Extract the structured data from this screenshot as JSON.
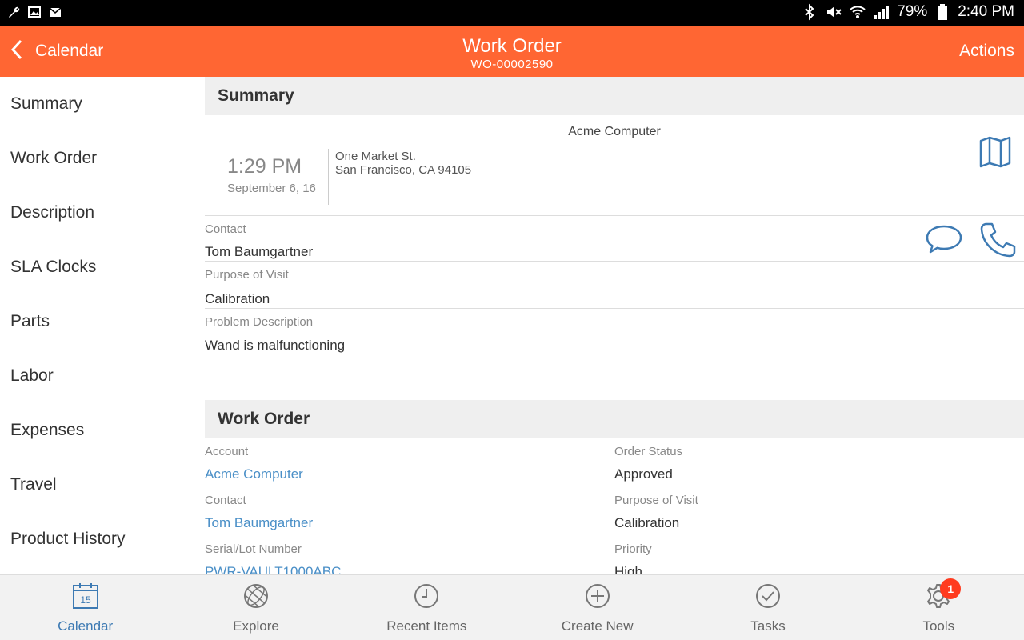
{
  "status_bar": {
    "battery": "79%",
    "time": "2:40 PM"
  },
  "header": {
    "back_label": "Calendar",
    "title": "Work Order",
    "subtitle": "WO-00002590",
    "actions_label": "Actions",
    "accent_color": "#ff6633"
  },
  "sidebar": {
    "items": [
      {
        "label": "Summary"
      },
      {
        "label": "Work Order"
      },
      {
        "label": "Description"
      },
      {
        "label": "SLA Clocks"
      },
      {
        "label": "Parts"
      },
      {
        "label": "Labor"
      },
      {
        "label": "Expenses"
      },
      {
        "label": "Travel"
      },
      {
        "label": "Product History"
      }
    ]
  },
  "summary": {
    "header": "Summary",
    "account_name": "Acme Computer",
    "time": "1:29 PM",
    "date": "September 6, 16",
    "address_line1": "One Market St.",
    "address_line2": "San Francisco, CA 94105",
    "contact_label": "Contact",
    "contact_value": "Tom Baumgartner",
    "purpose_label": "Purpose of Visit",
    "purpose_value": "Calibration",
    "problem_label": "Problem Description",
    "problem_value": "Wand is malfunctioning"
  },
  "work_order": {
    "header": "Work Order",
    "account_label": "Account",
    "account_value": "Acme Computer",
    "order_status_label": "Order Status",
    "order_status_value": "Approved",
    "contact_label": "Contact",
    "contact_value": "Tom Baumgartner",
    "purpose_label": "Purpose of Visit",
    "purpose_value": "Calibration",
    "serial_label": "Serial/Lot Number",
    "serial_value": "PWR-VAULT1000ABC",
    "priority_label": "Priority",
    "priority_value": "High"
  },
  "tabs": [
    {
      "label": "Calendar",
      "icon": "calendar-icon",
      "calendar_day": "15"
    },
    {
      "label": "Explore",
      "icon": "globe-icon"
    },
    {
      "label": "Recent Items",
      "icon": "clock-icon"
    },
    {
      "label": "Create New",
      "icon": "plus-circle-icon"
    },
    {
      "label": "Tasks",
      "icon": "check-circle-icon"
    },
    {
      "label": "Tools",
      "icon": "gear-icon",
      "badge": "1"
    }
  ]
}
